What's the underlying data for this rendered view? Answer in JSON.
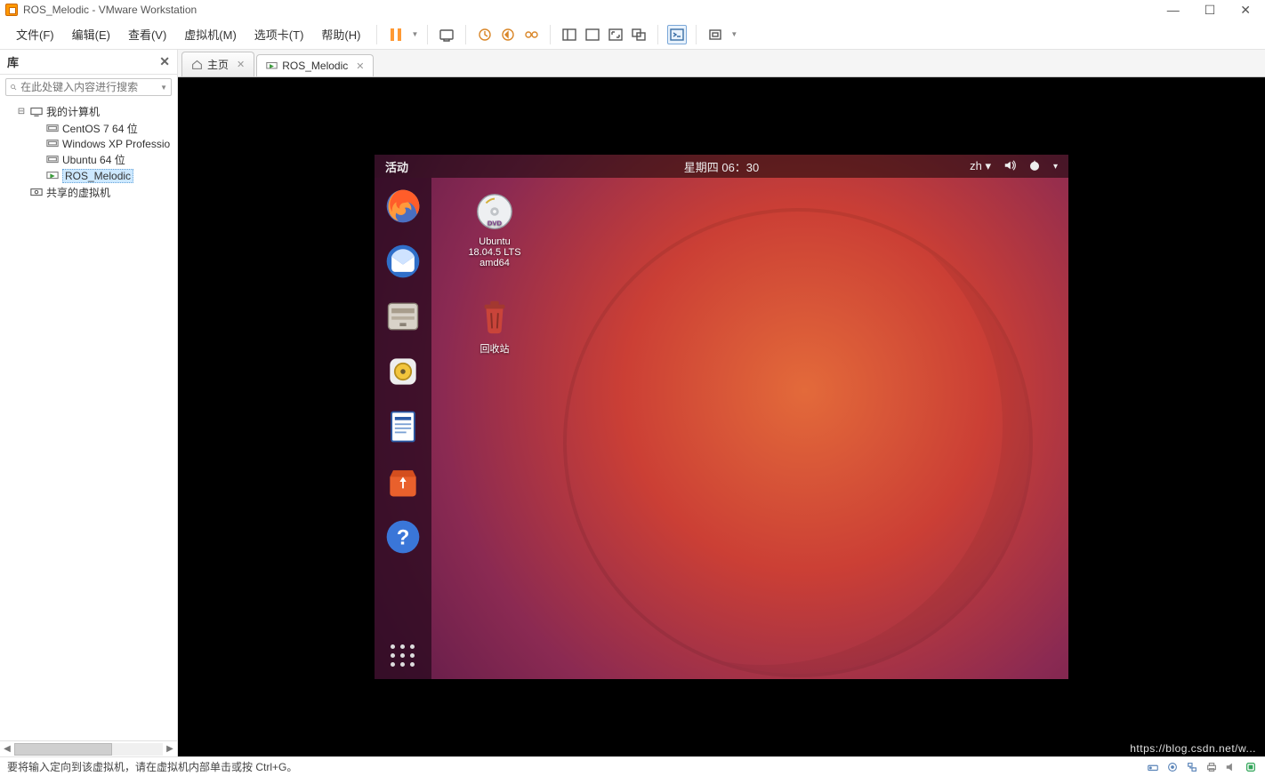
{
  "window": {
    "title": "ROS_Melodic - VMware Workstation"
  },
  "menu": {
    "file": "文件(F)",
    "edit": "编辑(E)",
    "view": "查看(V)",
    "vm": "虚拟机(M)",
    "tabs": "选项卡(T)",
    "help": "帮助(H)"
  },
  "library": {
    "header": "库",
    "search_placeholder": "在此处键入内容进行搜索",
    "root": "我的计算机",
    "items": [
      "CentOS 7 64 位",
      "Windows XP Professio",
      "Ubuntu 64 位",
      "ROS_Melodic"
    ],
    "shared": "共享的虚拟机"
  },
  "tabs": {
    "home": "主页",
    "vm": "ROS_Melodic"
  },
  "ubuntu": {
    "activities": "活动",
    "datetime": "星期四 06：30",
    "lang": "zh",
    "dvd_lines": [
      "Ubuntu",
      "18.04.5 LTS",
      "amd64"
    ],
    "trash": "回收站"
  },
  "status": {
    "text": "要将输入定向到该虚拟机，请在虚拟机内部单击或按 Ctrl+G。"
  },
  "watermark": "https://blog.csdn.net/w..."
}
